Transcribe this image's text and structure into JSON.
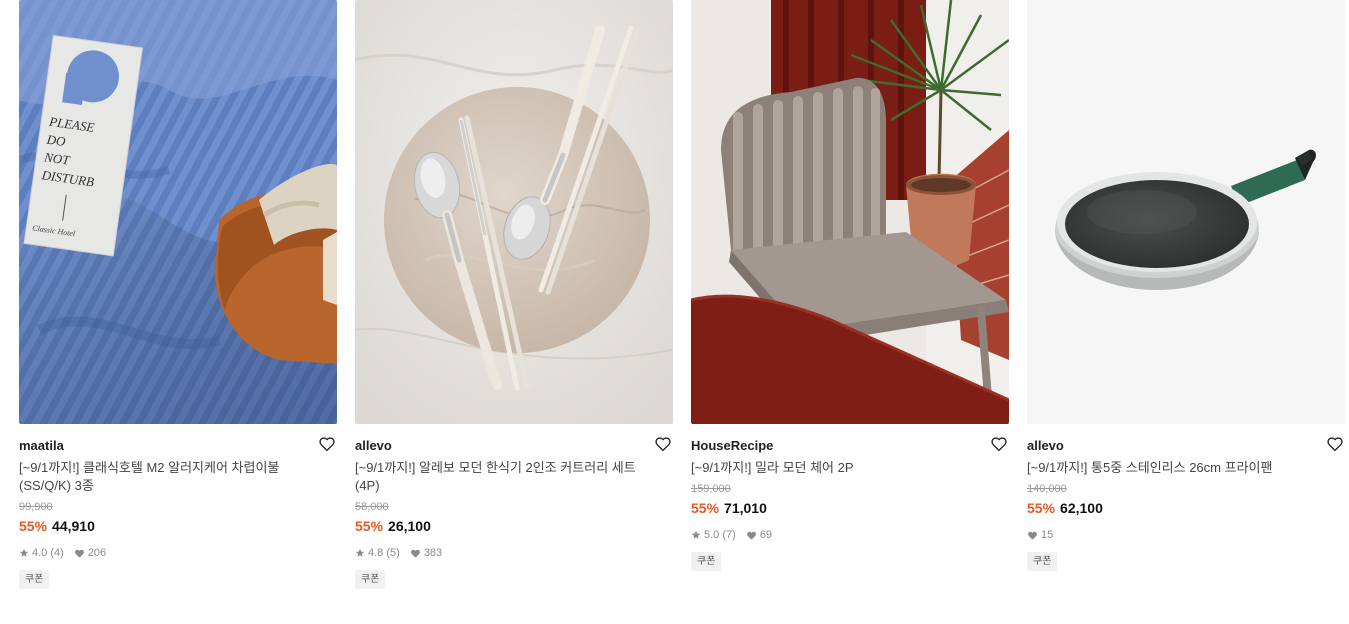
{
  "products": [
    {
      "brand": "maatila",
      "name": "[~9/1까지!] 클래식호텔 M2 알러지케어 차렵이불(SS/Q/K) 3종",
      "original_price": "99,900",
      "discount_rate": "55%",
      "price": "44,910",
      "rating": "4.0",
      "review_count": "(4)",
      "likes": "206",
      "badge": "쿠폰",
      "image_text": {
        "tag_line1": "PLEASE",
        "tag_line2": "DO",
        "tag_line3": "NOT",
        "tag_line4": "DISTURB",
        "tag_brand": "Classic Hotel"
      }
    },
    {
      "brand": "allevo",
      "name": "[~9/1까지!] 알레보 모던 한식기 2인조 커트러리 세트 (4P)",
      "original_price": "58,000",
      "discount_rate": "55%",
      "price": "26,100",
      "rating": "4.8",
      "review_count": "(5)",
      "likes": "383",
      "badge": "쿠폰"
    },
    {
      "brand": "HouseRecipe",
      "name": "[~9/1까지!] 밀라 모던 체어 2P",
      "original_price": "159,000",
      "discount_rate": "55%",
      "price": "71,010",
      "rating": "5.0",
      "review_count": "(7)",
      "likes": "69",
      "badge": "쿠폰"
    },
    {
      "brand": "allevo",
      "name": "[~9/1까지!] 통5중 스테인리스 26cm 프라이팬",
      "original_price": "140,000",
      "discount_rate": "55%",
      "price": "62,100",
      "likes": "15",
      "badge": "쿠폰"
    }
  ],
  "colors": {
    "discount": "#e55b24",
    "text_primary": "#222222",
    "text_muted": "#8a8a8a",
    "badge_bg": "#f1f1f1"
  },
  "icons": {
    "wishlist": "heart-outline-icon",
    "rating": "star-icon",
    "likes": "heart-filled-icon"
  }
}
